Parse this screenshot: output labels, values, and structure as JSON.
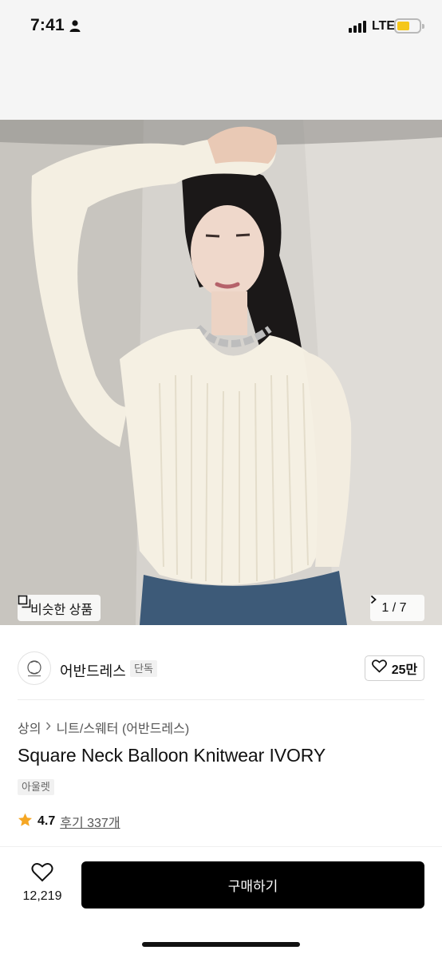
{
  "status_bar": {
    "time": "7:41",
    "network": "LTE",
    "person_icon": "person-icon",
    "battery_color": "#f5c71a"
  },
  "gallery": {
    "similar_label": "비슷한 상품",
    "similar_icon": "copy-icon",
    "counter_text": "1 / 7",
    "next_icon": "chevron-right-icon"
  },
  "seller": {
    "name": "어반드레스",
    "badge": "단독",
    "like_count": "25만",
    "like_icon": "heart-outline-icon"
  },
  "product": {
    "breadcrumb": [
      "상의",
      "니트/스웨터 (어반드레스)"
    ],
    "title": "Square Neck Balloon Knitwear IVORY",
    "outlet_tag": "아울렛",
    "rating": "4.7",
    "reviews": "후기 337개",
    "star_color": "#f5a623"
  },
  "bottom_bar": {
    "wish_count": "12,219",
    "buy_label": "구매하기",
    "buy_color": "#000000"
  }
}
